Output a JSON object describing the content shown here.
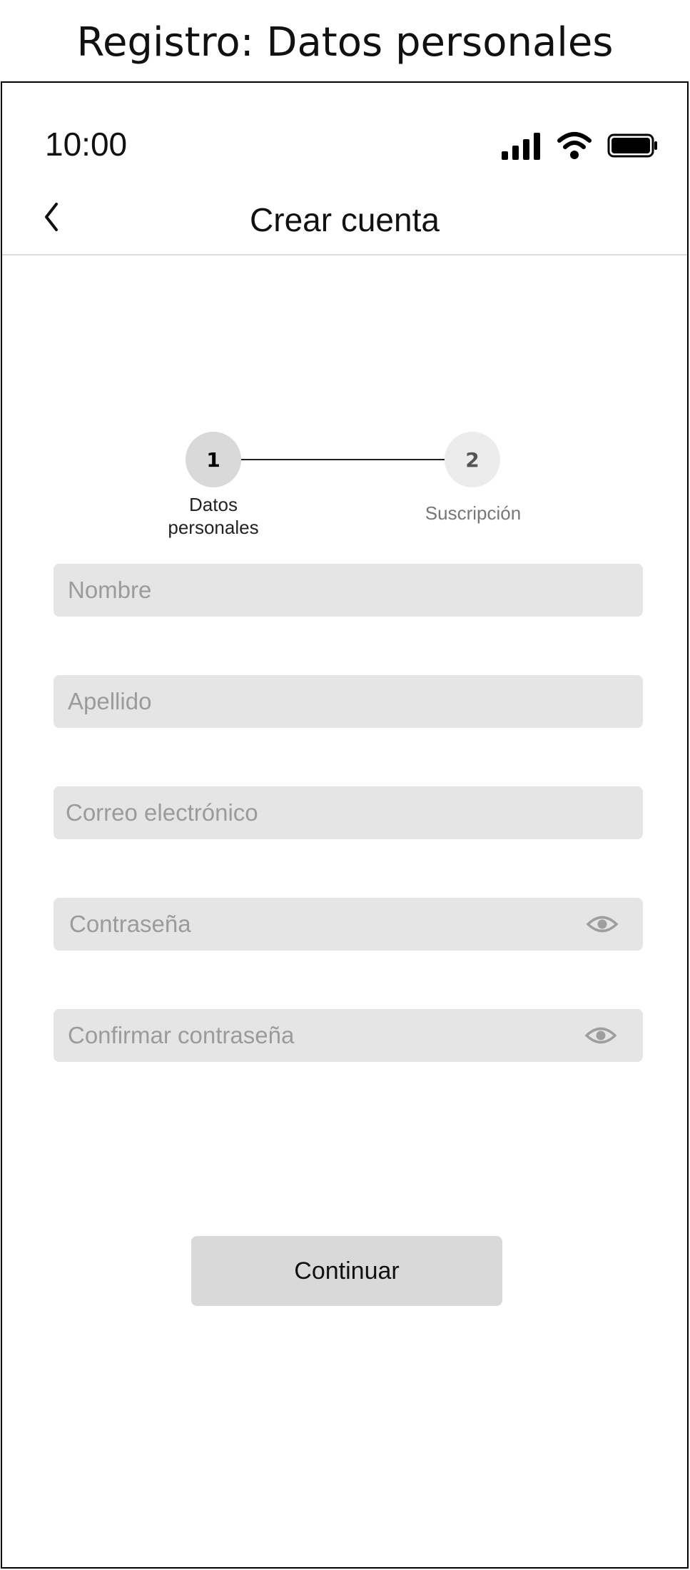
{
  "caption": "Registro: Datos personales",
  "status_bar": {
    "time": "10:00",
    "icons": [
      "signal-icon",
      "wifi-icon",
      "battery-icon"
    ]
  },
  "nav": {
    "back_icon": "chevron-left-icon",
    "title": "Crear cuenta"
  },
  "stepper": {
    "steps": [
      {
        "number": "1",
        "label_line1": "Datos",
        "label_line2": "personales",
        "state": "active"
      },
      {
        "number": "2",
        "label": "Suscripción",
        "state": "inactive"
      }
    ]
  },
  "form": {
    "fields": [
      {
        "placeholder": "Nombre",
        "value": ""
      },
      {
        "placeholder": "Apellido",
        "value": ""
      },
      {
        "placeholder": "Correo electrónico",
        "value": ""
      },
      {
        "placeholder": "Contraseña",
        "value": "",
        "icon": "eye-icon"
      },
      {
        "placeholder": "Confirmar contraseña",
        "value": "",
        "icon": "eye-icon"
      }
    ],
    "submit_label": "Continuar"
  },
  "colors": {
    "field_background": "#e5e5e5",
    "button_background": "#d9d9d9",
    "active_step": "#d9d9d9",
    "inactive_step": "#ececec",
    "placeholder_text": "#9b9b9b"
  }
}
